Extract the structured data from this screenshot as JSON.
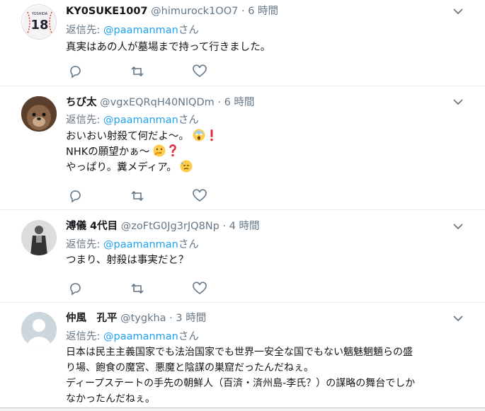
{
  "tweets": [
    {
      "name": "KY0SUKE1007",
      "handle": "@himurock1OO7",
      "sep": "·",
      "time": "6 時間",
      "reply_label": "返信先:",
      "reply_mention": "@paamanman",
      "reply_suffix": "さん",
      "lines": [
        "真実はあの人が墓場まで持って行きました。"
      ],
      "avatar_text": "18"
    },
    {
      "name": "ちび太",
      "handle": "@vgxEQRqH40NlQDm",
      "sep": "·",
      "time": "6 時間",
      "reply_label": "返信先:",
      "reply_mention": "@paamanman",
      "reply_suffix": "さん",
      "lines": [
        "おいおい射殺て何だよ〜。",
        "NHKの願望かぁ〜",
        "やっぱり。糞メディア。"
      ]
    },
    {
      "name": "溥儀 4代目",
      "handle": "@zoFtG0Jg3rJQ8Np",
      "sep": "·",
      "time": "4 時間",
      "reply_label": "返信先:",
      "reply_mention": "@paamanman",
      "reply_suffix": "さん",
      "lines": [
        "つまり、射殺は事実だと？"
      ]
    },
    {
      "name": "仲風　孔平",
      "handle": "@tygkha",
      "sep": "·",
      "time": "3 時間",
      "reply_label": "返信先:",
      "reply_mention": "@paamanman",
      "reply_suffix": "さん",
      "lines": [
        "日本は民主主義国家でも法治国家でも世界一安全な国でもない魑魅魍魎らの盛",
        "り場、飽食の魔宮、悪魔と陰謀の巣窟だったんだねぇ。",
        "ディープステートの手先の朝鮮人（百済・済州島-李氏？）の謀略の舞台でしか",
        "なかったんだねぇ。"
      ]
    }
  ],
  "colors": {
    "link": "#1da1f2",
    "muted": "#657786",
    "text": "#14171a",
    "divider": "#e6ecf0"
  },
  "icons": [
    "reply-icon",
    "retweet-icon",
    "like-icon",
    "caret-down-icon"
  ]
}
